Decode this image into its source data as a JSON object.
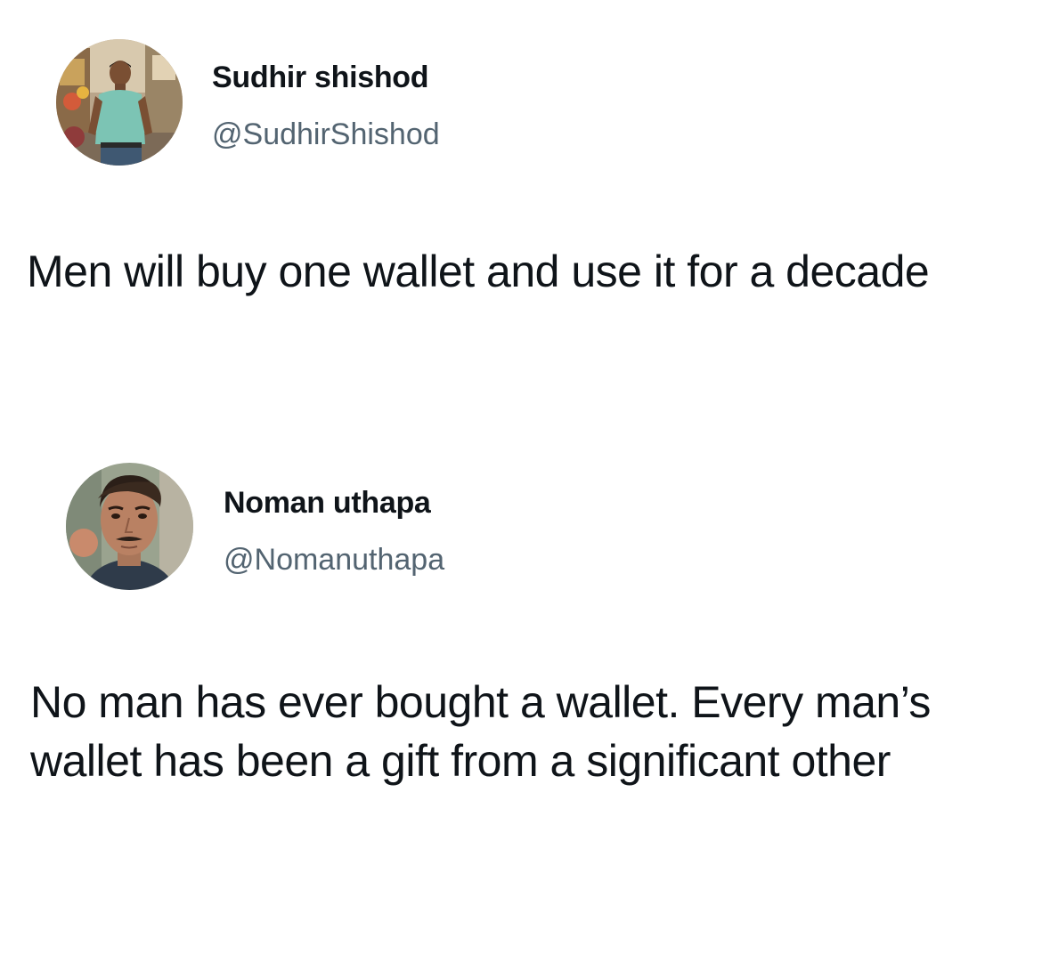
{
  "tweets": [
    {
      "author": {
        "display_name": "Sudhir shishod",
        "handle": "@SudhirShishod",
        "avatar_icon": "user-avatar-photo"
      },
      "text": "Men will buy one wallet and use it for a decade"
    },
    {
      "author": {
        "display_name": "Noman uthapa",
        "handle": "@Nomanuthapa",
        "avatar_icon": "user-avatar-photo"
      },
      "text": "No man has ever bought a wallet. Every man’s wallet has been a gift from a significant other"
    }
  ],
  "colors": {
    "text_primary": "#0f1419",
    "text_secondary": "#536471",
    "background": "#ffffff"
  }
}
